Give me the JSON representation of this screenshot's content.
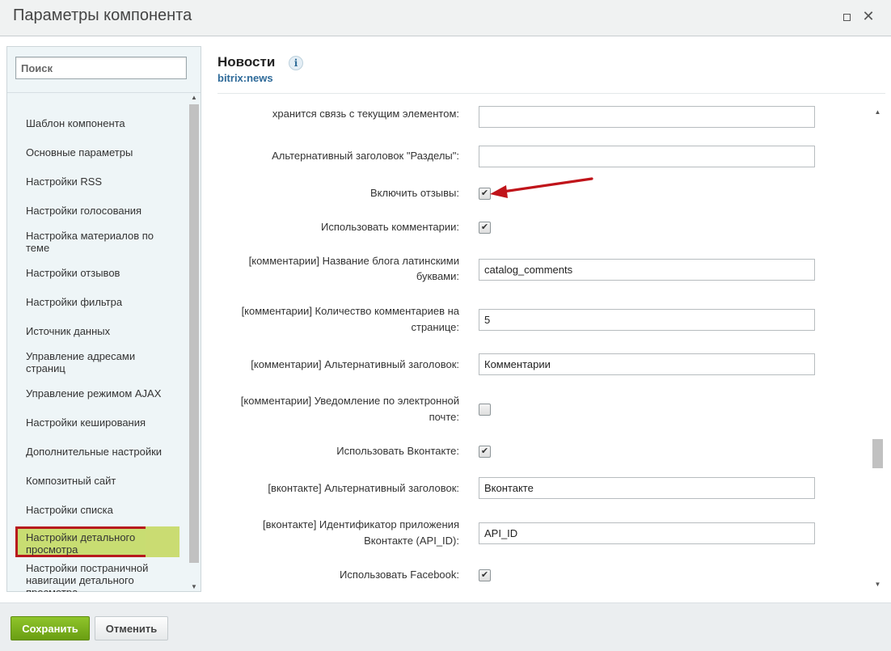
{
  "window": {
    "title": "Параметры компонента",
    "maximize_icon": "maximize-icon",
    "close_icon": "close-icon",
    "close_glyph": "✕"
  },
  "search": {
    "placeholder": "Поиск",
    "value": ""
  },
  "sidebar": {
    "items": [
      {
        "label": "Шаблон компонента"
      },
      {
        "label": "Основные параметры"
      },
      {
        "label": "Настройки RSS"
      },
      {
        "label": "Настройки голосования"
      },
      {
        "label": "Настройка материалов по теме"
      },
      {
        "label": "Настройки отзывов"
      },
      {
        "label": "Настройки фильтра"
      },
      {
        "label": "Источник данных"
      },
      {
        "label": "Управление адресами страниц"
      },
      {
        "label": "Управление режимом AJAX"
      },
      {
        "label": "Настройки кеширования"
      },
      {
        "label": "Дополнительные настройки"
      },
      {
        "label": "Композитный сайт"
      },
      {
        "label": "Настройки списка"
      },
      {
        "label": "Настройки детального просмотра",
        "active": true
      },
      {
        "label": "Настройки постраничной навигации детального просмотра"
      }
    ]
  },
  "component": {
    "title": "Новости",
    "info_glyph": "i",
    "code": "bitrix:news"
  },
  "form": {
    "rows": [
      {
        "label": "хранится связь с текущим элементом:",
        "type": "text",
        "value": ""
      },
      {
        "label": "Альтернативный заголовок \"Разделы\":",
        "type": "text",
        "value": ""
      },
      {
        "label": "Включить отзывы:",
        "type": "checkbox",
        "checked": true
      },
      {
        "label": "Использовать комментарии:",
        "type": "checkbox",
        "checked": true
      },
      {
        "label_line1": "[комментарии] Название блога латинскими",
        "label_line2": "буквами:",
        "type": "text",
        "value": "catalog_comments"
      },
      {
        "label_line1": "[комментарии] Количество комментариев на",
        "label_line2": "странице:",
        "type": "text",
        "value": "5"
      },
      {
        "label": "[комментарии] Альтернативный заголовок:",
        "type": "text",
        "value": "Комментарии"
      },
      {
        "label_line1": "[комментарии] Уведомление по электронной",
        "label_line2": "почте:",
        "type": "checkbox",
        "checked": false
      },
      {
        "label": "Использовать Вконтакте:",
        "type": "checkbox",
        "checked": true
      },
      {
        "label": "[вконтакте] Альтернативный заголовок:",
        "type": "text",
        "value": "Вконтакте"
      },
      {
        "label_line1": "[вконтакте] Идентификатор приложения",
        "label_line2": "Вконтакте (API_ID):",
        "type": "text",
        "value": "API_ID"
      },
      {
        "label": "Использовать Facebook:",
        "type": "checkbox",
        "checked": true
      }
    ],
    "check_glyph": "✔"
  },
  "annotation": {
    "arrow_color": "#c0141a",
    "icon": "red-arrow-annotation"
  },
  "scroll": {
    "up_glyph": "▲",
    "down_glyph": "▼"
  },
  "footer": {
    "save_label": "Сохранить",
    "cancel_label": "Отменить"
  },
  "colors": {
    "accent_green": "#7ab41d",
    "active_item_bg": "#c8dd72",
    "highlight_border": "#b7191d",
    "link_blue": "#2e6a99"
  }
}
